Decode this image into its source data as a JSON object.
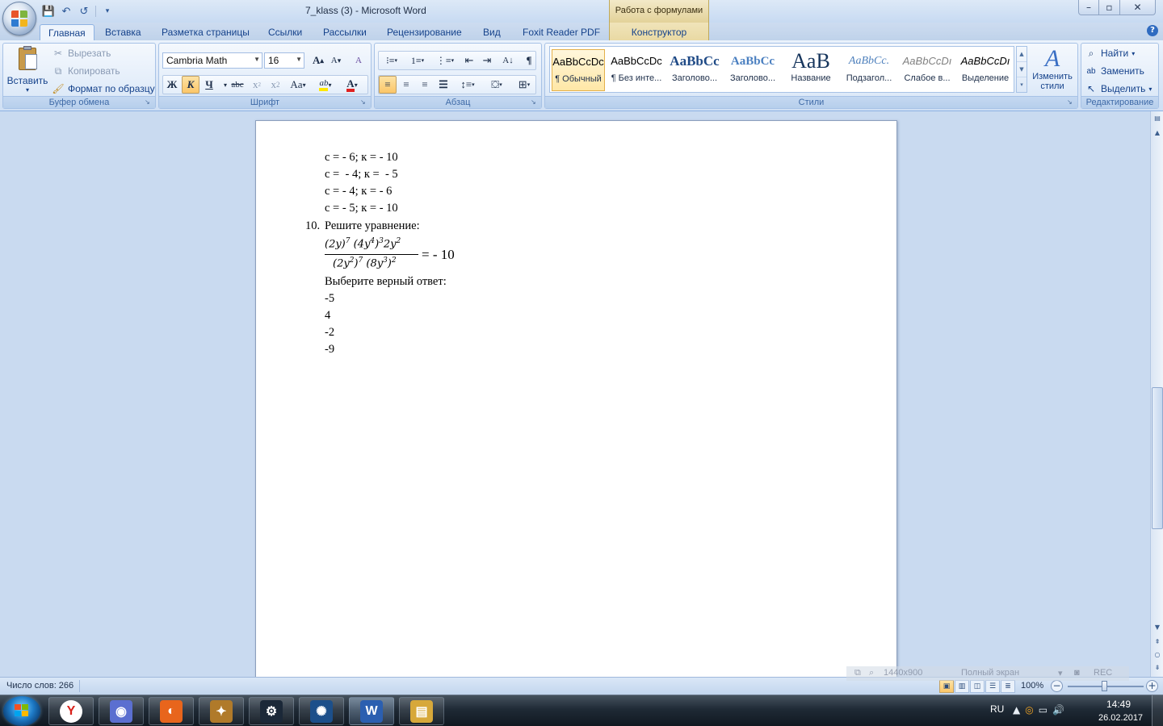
{
  "window": {
    "title": "7_klass (3) - Microsoft Word",
    "context_title": "Работа с формулами",
    "controls": {
      "minimize": "–",
      "maximize": "▫",
      "close": "✕"
    }
  },
  "qat": {
    "save_icon": "💾",
    "undo_icon": "↶",
    "redo_icon": "↺",
    "customize_icon": "▾"
  },
  "tabs": [
    {
      "label": "Главная"
    },
    {
      "label": "Вставка"
    },
    {
      "label": "Разметка страницы"
    },
    {
      "label": "Ссылки"
    },
    {
      "label": "Рассылки"
    },
    {
      "label": "Рецензирование"
    },
    {
      "label": "Вид"
    },
    {
      "label": "Foxit Reader PDF"
    },
    {
      "label": "Конструктор"
    }
  ],
  "clipboard": {
    "group_label": "Буфер обмена",
    "paste_label": "Вставить",
    "cut_label": "Вырезать",
    "copy_label": "Копировать",
    "format_painter_label": "Формат по образцу"
  },
  "font": {
    "group_label": "Шрифт",
    "font_name": "Cambria Math",
    "font_size": "16",
    "grow": "A",
    "shrink": "A",
    "clear": "A",
    "bold": "Ж",
    "italic": "К",
    "underline": "Ч",
    "strike": "abc",
    "subscript": "x",
    "superscript": "x",
    "change_case": "Aa",
    "highlight": "ab",
    "font_color": "A"
  },
  "paragraph": {
    "group_label": "Абзац",
    "show_marks": "¶"
  },
  "styles": {
    "group_label": "Стили",
    "items": [
      {
        "sample": "AaBbCcDc",
        "name": "¶ Обычный"
      },
      {
        "sample": "AaBbCcDc",
        "name": "¶ Без инте..."
      },
      {
        "sample": "AaBbCc",
        "name": "Заголово..."
      },
      {
        "sample": "AaBbCc",
        "name": "Заголово..."
      },
      {
        "sample": "AaB",
        "name": "Название"
      },
      {
        "sample": "AaBbCc.",
        "name": "Подзагол..."
      },
      {
        "sample": "AaBbCcDı",
        "name": "Слабое в..."
      },
      {
        "sample": "AaBbCcDı",
        "name": "Выделение"
      }
    ],
    "change_styles_label": "Изменить стили"
  },
  "editing": {
    "group_label": "Редактирование",
    "find_label": "Найти",
    "replace_label": "Заменить",
    "select_label": "Выделить"
  },
  "document": {
    "answer_lines": [
      "с = - 6; к = - 10",
      "с =  - 4; к =  - 5",
      "с = - 4; к = - 6",
      "с = - 5; к = - 10"
    ],
    "question_number": "10.",
    "question_text": "Решите уравнение:",
    "equation": {
      "num_a": "(2y)",
      "num_a_exp": "7",
      "num_b": "(4y",
      "num_b_inner_exp": "4",
      "num_b_close": ")",
      "num_b_exp": "3",
      "num_c": "2y",
      "num_c_exp": "2",
      "den_a": "(2y",
      "den_a_inner_exp": "2",
      "den_a_close": ")",
      "den_a_exp": "7",
      "den_b": "(8y",
      "den_b_inner_exp": "3",
      "den_b_close": ")",
      "den_b_exp": "2",
      "rhs": "= - 10"
    },
    "prompt": "Выберите верный ответ:",
    "options": [
      "-5",
      "4",
      "-2",
      "-9"
    ]
  },
  "statusbar": {
    "word_count": "Число слов: 266",
    "zoom": "100%",
    "overlay_resolution": "1440x900",
    "overlay_fullscreen": "Полный экран",
    "overlay_rec": "REC"
  },
  "taskbar": {
    "apps": [
      {
        "name": "yandex-browser",
        "glyph": "Y",
        "color": "#d9201a"
      },
      {
        "name": "discord",
        "glyph": "◉",
        "color": "#5b6fd0"
      },
      {
        "name": "firefox",
        "glyph": "◐",
        "color": "#e8651c"
      },
      {
        "name": "hearthstone",
        "glyph": "✦",
        "color": "#b07a2a"
      },
      {
        "name": "steam",
        "glyph": "⚙",
        "color": "#1b2838"
      },
      {
        "name": "battlenet",
        "glyph": "✺",
        "color": "#1c4f8a"
      },
      {
        "name": "word",
        "glyph": "W",
        "color": "#2b5fb0"
      },
      {
        "name": "explorer",
        "glyph": "▤",
        "color": "#d7a83a"
      }
    ],
    "language": "RU",
    "time": "14:49",
    "date": "26.02.2017"
  }
}
